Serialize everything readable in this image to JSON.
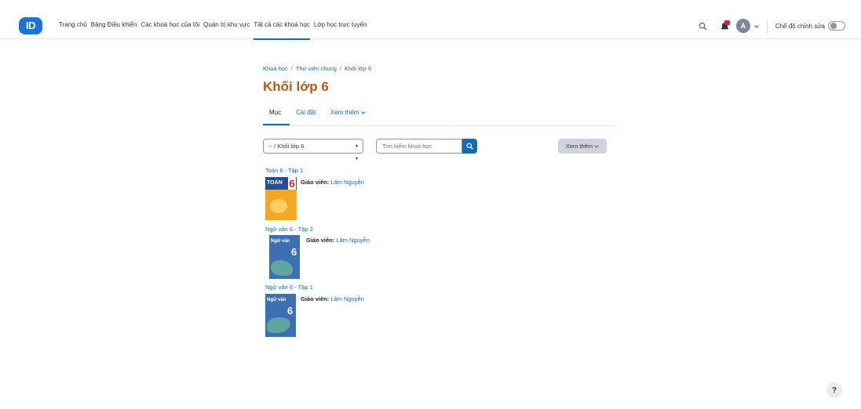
{
  "brand": {
    "logo_text": "ID"
  },
  "nav": {
    "items": [
      {
        "label": "Trang chủ"
      },
      {
        "label": "Bảng Điều khiển"
      },
      {
        "label": "Các khoá học của tôi"
      },
      {
        "label": "Quản trị khu vực"
      },
      {
        "label": "Tất cả các khoá học"
      },
      {
        "label": "Lớp học trực tuyến"
      }
    ],
    "active_index": 4
  },
  "user": {
    "avatar_initial": "A",
    "edit_mode_label": "Chế độ chỉnh sửa"
  },
  "breadcrumb": {
    "items": [
      "Khoá học",
      "Thư viện chung",
      "Khối lớp 6"
    ],
    "separator": "/"
  },
  "page": {
    "title": "Khối lớp 6"
  },
  "tabs": [
    {
      "label": "Mục"
    },
    {
      "label": "Cài đặt"
    },
    {
      "label": "Xem thêm"
    }
  ],
  "filters": {
    "category_select": "-- / Khối lớp 6",
    "search_placeholder": "Tìm kiếm khoá học",
    "more_button": "Xem thêm"
  },
  "courses": [
    {
      "name": "Toán 6 - Tập 1",
      "teacher_label": "Giáo viên:",
      "teacher": "Lâm Nguyễn",
      "cover_text": "TOÁN",
      "cover_num": "6"
    },
    {
      "name": "Ngữ văn 6 - Tập 2",
      "teacher_label": "Giáo viên:",
      "teacher": "Lâm Nguyễn",
      "cover_text": "Ngữ văn",
      "cover_num": "6"
    },
    {
      "name": "Ngữ văn 6 - Tập 1",
      "teacher_label": "Giáo viên:",
      "teacher": "Lâm Nguyễn",
      "cover_text": "Ngữ văn",
      "cover_num": "6"
    }
  ],
  "help": {
    "label": "?"
  },
  "colors": {
    "accent": "#0f6cbf",
    "title": "#b25b1a",
    "notification": "#d9262f"
  }
}
